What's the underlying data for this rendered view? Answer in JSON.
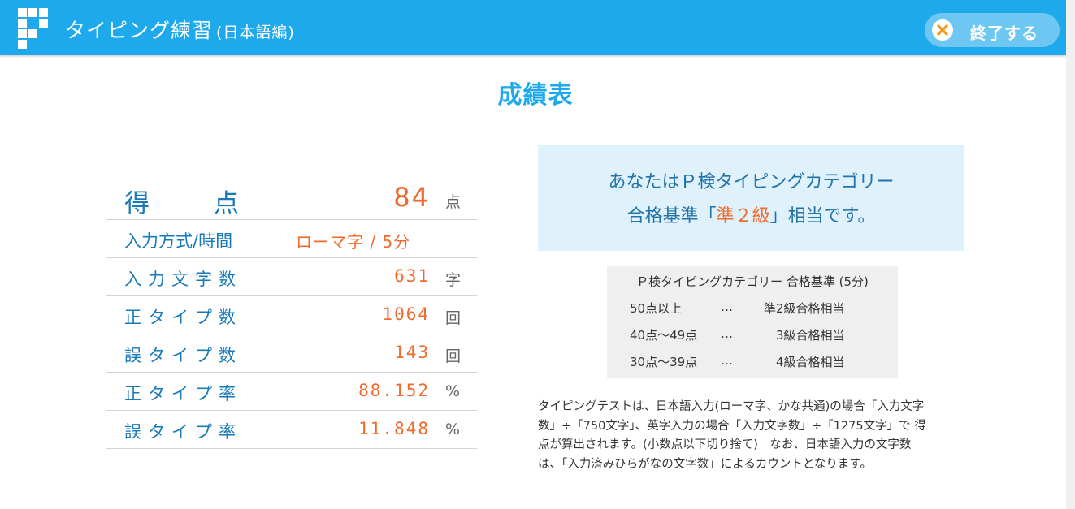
{
  "header": {
    "title": "タイピング練習",
    "subtitle": "(日本語編)",
    "exit_label": "終了する"
  },
  "page_title": "成績表",
  "score": {
    "label_left": "得",
    "label_right": "点",
    "value": "84",
    "unit": "点"
  },
  "method": {
    "label": "入力方式/時間",
    "value": "ローマ字 / 5分"
  },
  "stats": [
    {
      "label": "入力文字数",
      "value": "631",
      "unit": "字"
    },
    {
      "label": "正タイプ数",
      "value": "1064",
      "unit": "回"
    },
    {
      "label": "誤タイプ数",
      "value": "143",
      "unit": "回"
    },
    {
      "label": "正タイプ率",
      "value": "88.152",
      "unit": "%"
    },
    {
      "label": "誤タイプ率",
      "value": "11.848",
      "unit": "%"
    }
  ],
  "result": {
    "line1": "あなたはＰ検タイピングカテゴリー",
    "line2_prefix": "合格基準「",
    "grade": "準２級",
    "line2_suffix": "」相当です。"
  },
  "criteria": {
    "title": "Ｐ検タイピングカテゴリー 合格基準 (5分)",
    "rows": [
      {
        "score": "50点以上",
        "dots": "…",
        "grade": "準2級合格相当"
      },
      {
        "score": "40点～49点",
        "dots": "…",
        "grade": "　3級合格相当"
      },
      {
        "score": "30点～39点",
        "dots": "…",
        "grade": "　4級合格相当"
      }
    ]
  },
  "note": {
    "lines": [
      "タイピングテストは、日本語入力(ローマ字、かな共通)の場合「入力文字",
      "数」÷「750文字」、英字入力の場合「入力文字数」÷「1275文字」で 得",
      "点が算出されます。(小数点以下切り捨て)　なお、日本語入力の文字数",
      "は、「入力済みひらがなの文字数」によるカウントとなります。"
    ]
  },
  "colors": {
    "header_bg": "#1ea9ec",
    "accent_orange": "#ef6a2c",
    "label_blue": "#1a7ab8",
    "result_bg": "#dff2fc"
  }
}
